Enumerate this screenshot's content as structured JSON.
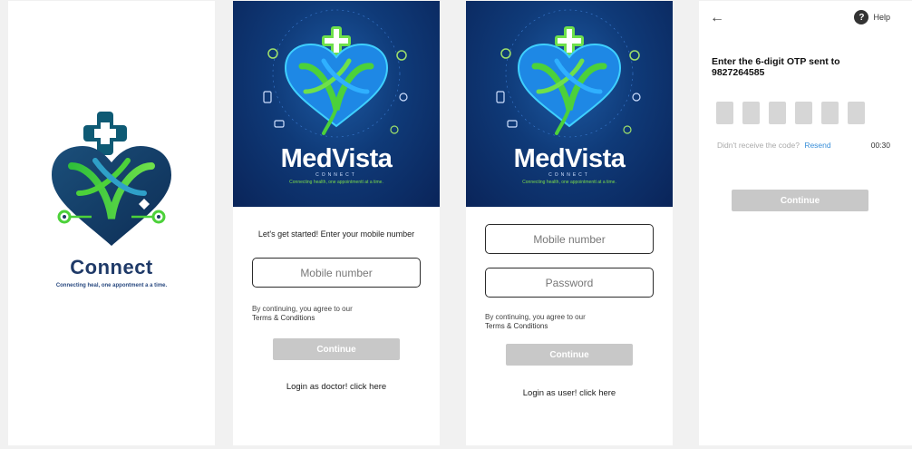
{
  "splash": {
    "brand_word": "Connect",
    "tagline": "Connecting heal, one appontment a a time."
  },
  "hero": {
    "brand": "MedVista",
    "sub": "CONNECT",
    "tagline": "Connecting health, one appointmentt at a time."
  },
  "user_login": {
    "prompt": "Let's get started! Enter your mobile number",
    "mobile_placeholder": "Mobile number",
    "terms_text": "By continuing, you agree to our",
    "terms_link": "Terms & Conditions",
    "continue_label": "Continue",
    "switch_link": "Login as doctor! click here"
  },
  "doctor_login": {
    "mobile_placeholder": "Mobile number",
    "password_placeholder": "Password",
    "terms_text": "By continuing, you agree to our",
    "terms_link": "Terms & Conditions",
    "continue_label": "Continue",
    "switch_link": "Login as user! click here"
  },
  "otp": {
    "help_label": "Help",
    "title": "Enter the 6-digit OTP sent to 9827264585",
    "resend_prompt": "Didn't receive the code?",
    "resend_link": "Resend",
    "timer": "00:30",
    "continue_label": "Continue"
  },
  "colors": {
    "disabled_button": "#c8c8c8",
    "link_blue": "#3a8fd8",
    "brand_green": "#4cd13a",
    "brand_navy": "#1f3a68"
  }
}
